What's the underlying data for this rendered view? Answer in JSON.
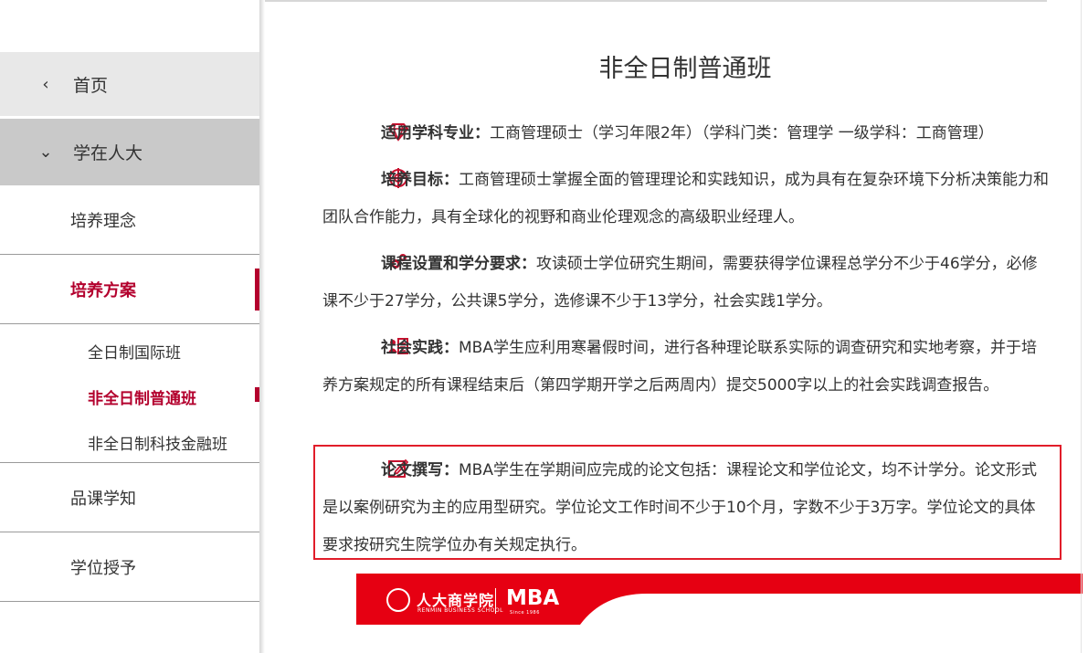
{
  "sidebar": {
    "home_label": "首页",
    "section_label": "学在人大",
    "items": [
      {
        "label": "培养理念"
      },
      {
        "label": "培养方案"
      },
      {
        "label": "品课学知"
      },
      {
        "label": "学位授予"
      }
    ],
    "sub_items": [
      {
        "label": "全日制国际班"
      },
      {
        "label": "非全日制普通班"
      },
      {
        "label": "非全日制科技金融班"
      }
    ]
  },
  "main": {
    "title": "非全日制普通班",
    "sections": [
      {
        "icon": "diamond-icon",
        "heading": "适用学科专业：",
        "text": "工商管理硕士（学习年限2年）（学科门类：管理学 一级学科：工商管理）"
      },
      {
        "icon": "target-icon",
        "heading": "培养目标：",
        "text": "工商管理硕士掌握全面的管理理论和实践知识，成为具有在复杂环境下分析决策能力和团队合作能力，具有全球化的视野和商业伦理观念的高级职业经理人。"
      },
      {
        "icon": "gears-icon",
        "heading": "课程设置和学分要求：",
        "text": "攻读硕士学位研究生期间，需要获得学位课程总学分不少于46学分，必修课不少于27学分，公共课5学分，选修课不少于13学分，社会实践1学分。"
      },
      {
        "icon": "user-list-icon",
        "heading": "社会实践：",
        "text": "MBA学生应利用寒暑假时间，进行各种理论联系实际的调查研究和实地考察，并于培养方案规定的所有课程结束后（第四学期开学之后两周内）提交5000字以上的社会实践调查报告。"
      },
      {
        "icon": "edit-icon",
        "heading": "论文撰写：",
        "text": "MBA学生在学期间应完成的论文包括：课程论文和学位论文，均不计学分。论文形式是以案例研究为主的应用型研究。学位论文工作时间不少于10个月，字数不少于3万字。学位论文的具体要求按研究生院学位办有关规定执行。"
      }
    ]
  },
  "banner": {
    "school_cn": "人大商学院",
    "school_en": "RENMIN BUSINESS SCHOOL",
    "program": "MBA",
    "since": "Since 1986"
  },
  "colors": {
    "accent": "#b3002d",
    "icon_red": "#c8102e",
    "highlight_border": "#e11d2a",
    "banner_red": "#e60012"
  }
}
